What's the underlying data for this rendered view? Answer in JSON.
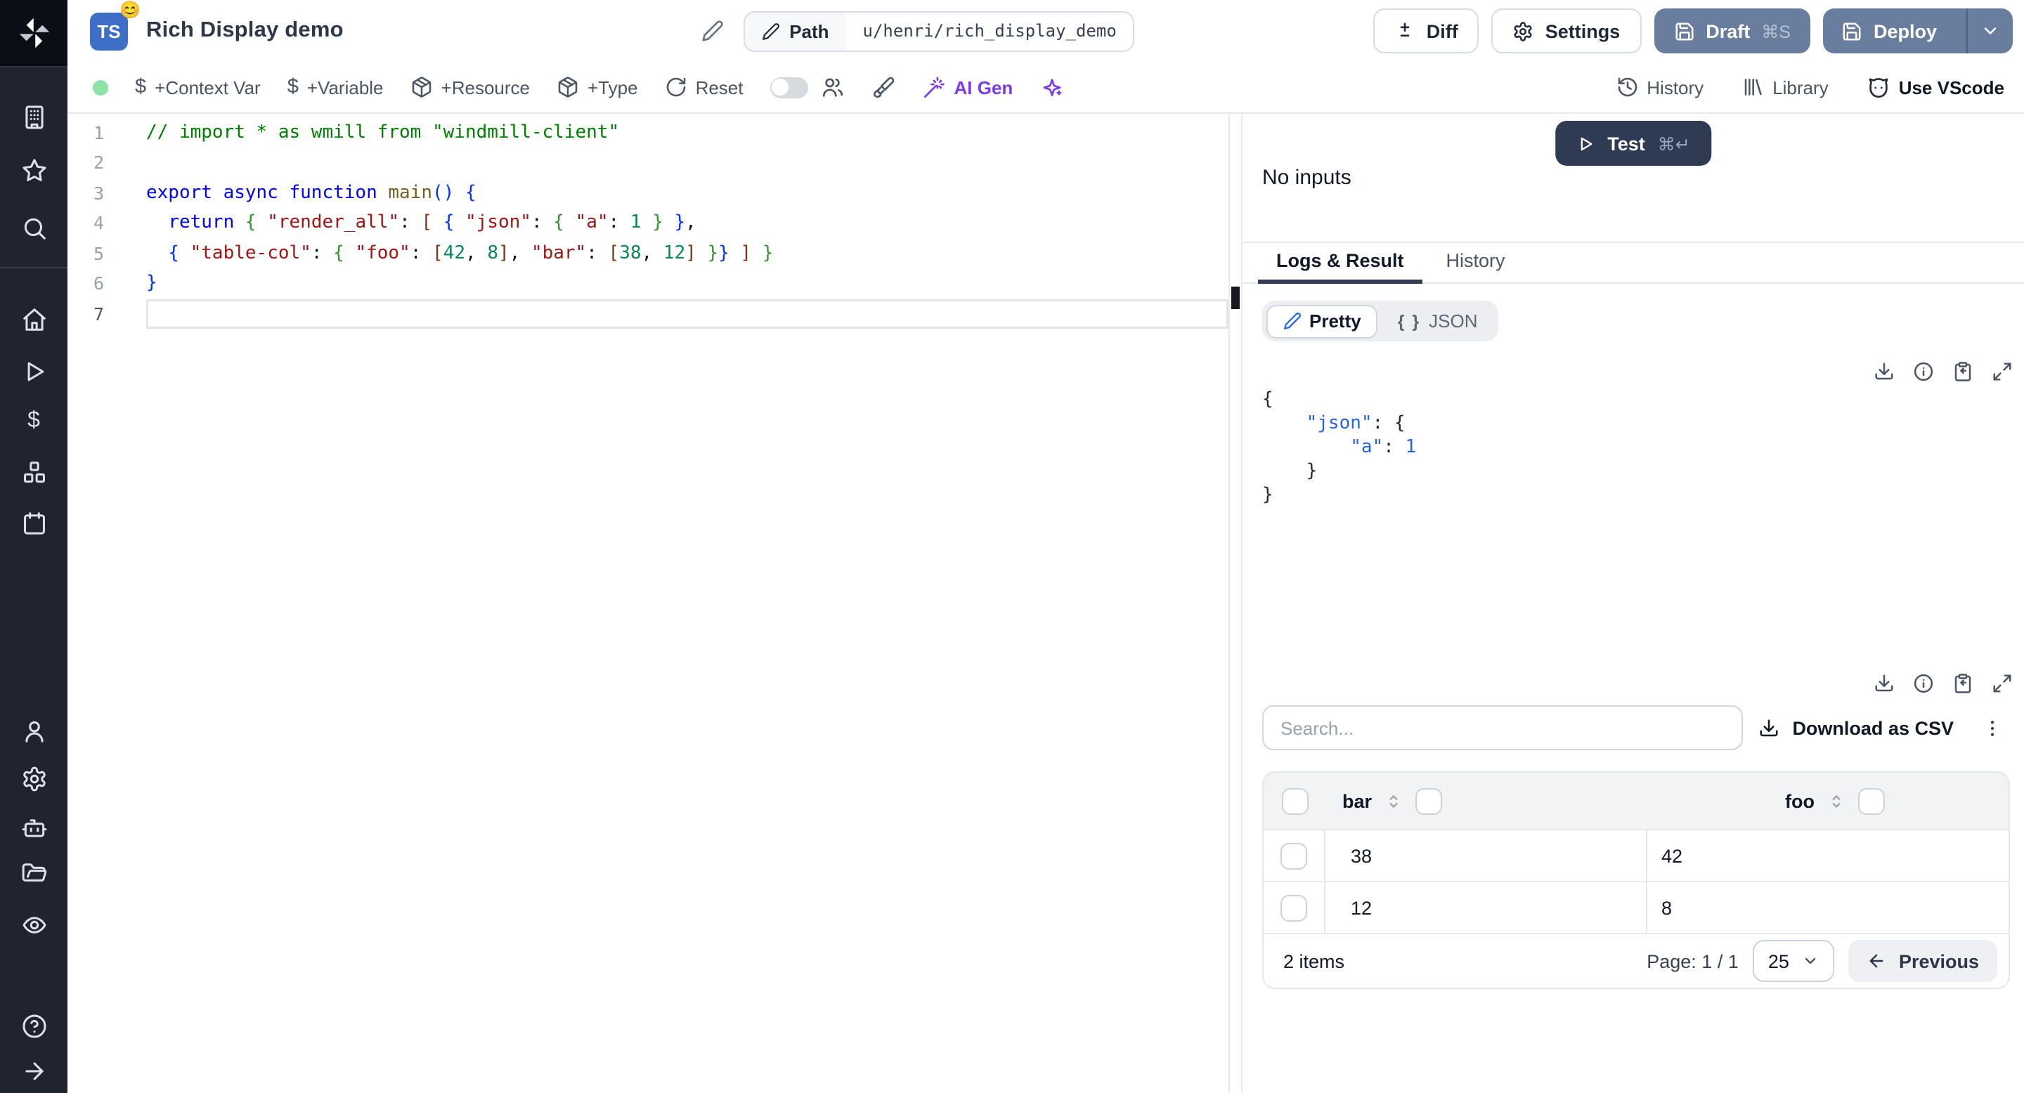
{
  "header": {
    "language_badge": "TS",
    "badge_emoji": "😊",
    "title": "Rich Display demo",
    "path_label": "Path",
    "path_value": "u/henri/rich_display_demo",
    "diff": "Diff",
    "settings": "Settings",
    "draft": "Draft",
    "draft_shortcut": "⌘S",
    "deploy": "Deploy"
  },
  "toolbar": {
    "context_var": "+Context Var",
    "variable": "+Variable",
    "resource": "+Resource",
    "type": "+Type",
    "reset": "Reset",
    "ai_gen": "AI Gen",
    "history": "History",
    "library": "Library",
    "use_vscode": "Use VScode"
  },
  "editor": {
    "lines": [
      {
        "num": "1",
        "tokens": [
          {
            "c": "cmt",
            "t": "// import * as wmill from \"windmill-client\""
          }
        ]
      },
      {
        "num": "2",
        "tokens": []
      },
      {
        "num": "3",
        "tokens": [
          {
            "c": "kw",
            "t": "export async function "
          },
          {
            "c": "fn",
            "t": "main"
          },
          {
            "c": "b1",
            "t": "()"
          },
          {
            "c": "pl",
            "t": " "
          },
          {
            "c": "b1",
            "t": "{"
          }
        ]
      },
      {
        "num": "4",
        "tokens": [
          {
            "c": "pl",
            "t": "  "
          },
          {
            "c": "kw",
            "t": "return"
          },
          {
            "c": "pl",
            "t": " "
          },
          {
            "c": "b2",
            "t": "{"
          },
          {
            "c": "pl",
            "t": " "
          },
          {
            "c": "str",
            "t": "\"render_all\""
          },
          {
            "c": "pl",
            "t": ": "
          },
          {
            "c": "b3",
            "t": "["
          },
          {
            "c": "pl",
            "t": " "
          },
          {
            "c": "b1",
            "t": "{"
          },
          {
            "c": "pl",
            "t": " "
          },
          {
            "c": "str",
            "t": "\"json\""
          },
          {
            "c": "pl",
            "t": ": "
          },
          {
            "c": "b2",
            "t": "{"
          },
          {
            "c": "pl",
            "t": " "
          },
          {
            "c": "str",
            "t": "\"a\""
          },
          {
            "c": "pl",
            "t": ": "
          },
          {
            "c": "num",
            "t": "1"
          },
          {
            "c": "pl",
            "t": " "
          },
          {
            "c": "b2",
            "t": "}"
          },
          {
            "c": "pl",
            "t": " "
          },
          {
            "c": "b1",
            "t": "}"
          },
          {
            "c": "pl",
            "t": ","
          }
        ]
      },
      {
        "num": "5",
        "tokens": [
          {
            "c": "pl",
            "t": "  "
          },
          {
            "c": "b1",
            "t": "{"
          },
          {
            "c": "pl",
            "t": " "
          },
          {
            "c": "str",
            "t": "\"table-col\""
          },
          {
            "c": "pl",
            "t": ": "
          },
          {
            "c": "b2",
            "t": "{"
          },
          {
            "c": "pl",
            "t": " "
          },
          {
            "c": "str",
            "t": "\"foo\""
          },
          {
            "c": "pl",
            "t": ": "
          },
          {
            "c": "b3",
            "t": "["
          },
          {
            "c": "num",
            "t": "42"
          },
          {
            "c": "pl",
            "t": ", "
          },
          {
            "c": "num",
            "t": "8"
          },
          {
            "c": "b3",
            "t": "]"
          },
          {
            "c": "pl",
            "t": ", "
          },
          {
            "c": "str",
            "t": "\"bar\""
          },
          {
            "c": "pl",
            "t": ": "
          },
          {
            "c": "b3",
            "t": "["
          },
          {
            "c": "num",
            "t": "38"
          },
          {
            "c": "pl",
            "t": ", "
          },
          {
            "c": "num",
            "t": "12"
          },
          {
            "c": "b3",
            "t": "]"
          },
          {
            "c": "pl",
            "t": " "
          },
          {
            "c": "b2",
            "t": "}"
          },
          {
            "c": "b1",
            "t": "}"
          },
          {
            "c": "pl",
            "t": " "
          },
          {
            "c": "b3",
            "t": "]"
          },
          {
            "c": "pl",
            "t": " "
          },
          {
            "c": "b2",
            "t": "}"
          }
        ]
      },
      {
        "num": "6",
        "tokens": [
          {
            "c": "b1",
            "t": "}"
          }
        ]
      },
      {
        "num": "7",
        "tokens": [],
        "current": true
      }
    ]
  },
  "run_panel": {
    "test": "Test",
    "test_shortcut": "⌘↵",
    "no_inputs": "No inputs"
  },
  "tabs": {
    "logs_result": "Logs & Result",
    "history": "History"
  },
  "result": {
    "pretty": "Pretty",
    "json_braces": "{ }",
    "json": "JSON",
    "lines": [
      [
        {
          "c": "p",
          "t": "{"
        }
      ],
      [
        {
          "c": "pl",
          "t": "    "
        },
        {
          "c": "key",
          "t": "\"json\""
        },
        {
          "c": "p",
          "t": ": {"
        }
      ],
      [
        {
          "c": "pl",
          "t": "        "
        },
        {
          "c": "key",
          "t": "\"a\""
        },
        {
          "c": "p",
          "t": ": "
        },
        {
          "c": "jn",
          "t": "1"
        }
      ],
      [
        {
          "c": "pl",
          "t": "    "
        },
        {
          "c": "p",
          "t": "}"
        }
      ],
      [
        {
          "c": "p",
          "t": "}"
        }
      ]
    ]
  },
  "table": {
    "search_placeholder": "Search...",
    "download_csv": "Download as CSV",
    "columns": [
      "bar",
      "foo"
    ],
    "rows": [
      [
        "38",
        "42"
      ],
      [
        "12",
        "8"
      ]
    ],
    "items": "2 items",
    "page": "Page: 1 / 1",
    "page_size": "25",
    "previous": "Previous"
  },
  "colors": {
    "accent_button": "#697e9f",
    "test_button": "#2f3b52",
    "badge_blue": "#3c6fc5",
    "ai_purple": "#7c3aed",
    "status_green": "#8ce3a5"
  }
}
